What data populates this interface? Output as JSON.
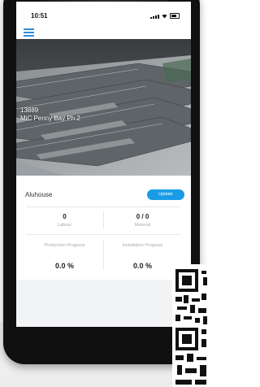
{
  "status_bar": {
    "time": "10:51"
  },
  "header": {
    "menu_icon": "hamburger-menu-icon"
  },
  "project": {
    "code": "13889",
    "name": "MiC Penny Bay Ph 2"
  },
  "card": {
    "title": "Aluhouse",
    "update_label": "Update",
    "labour": {
      "value": "0",
      "label": "Labour"
    },
    "material": {
      "value": "0 / 0",
      "label": "Material"
    },
    "production": {
      "label": "Production Progress",
      "value": "0.0 %"
    },
    "installation": {
      "label": "Installation Progress",
      "value": "0.0 %"
    }
  },
  "colors": {
    "accent": "#1a9be8",
    "menu": "#2b8de0"
  }
}
